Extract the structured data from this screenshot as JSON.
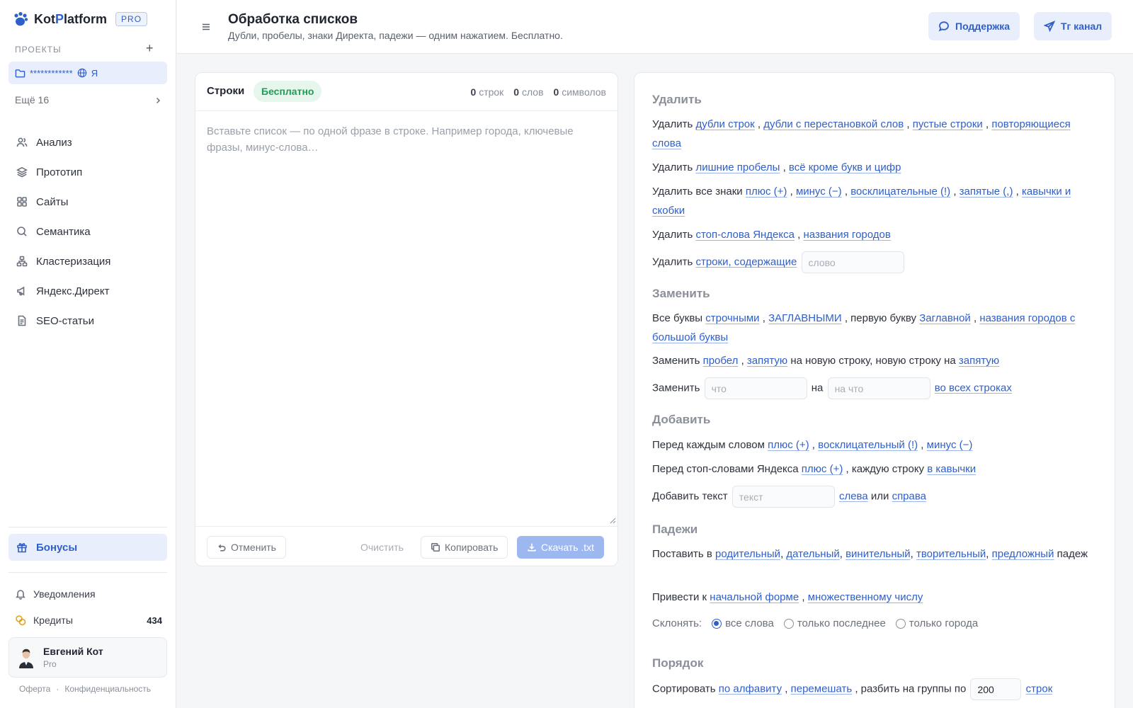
{
  "brand": {
    "name_pre": "Kot",
    "name_accent": "P",
    "name_post": "latform",
    "badge": "PRO"
  },
  "sidebar": {
    "projects_label": "ПРОЕКТЫ",
    "add_symbol": "+",
    "project": {
      "name": "************",
      "extra": "Я"
    },
    "more": "Ещё 16",
    "items": [
      {
        "label": "Анализ",
        "icon": "users-icon"
      },
      {
        "label": "Прототип",
        "icon": "layers-icon"
      },
      {
        "label": "Сайты",
        "icon": "grid-icon"
      },
      {
        "label": "Семантика",
        "icon": "search-icon"
      },
      {
        "label": "Кластеризация",
        "icon": "cluster-icon"
      },
      {
        "label": "Яндекс.Директ",
        "icon": "megaphone-icon"
      },
      {
        "label": "SEO-статьи",
        "icon": "document-icon"
      }
    ],
    "bonus": "Бонусы",
    "notifications": "Уведомления",
    "credits": {
      "label": "Кредиты",
      "value": "434"
    },
    "user": {
      "name": "Евгений Кот",
      "plan": "Pro"
    },
    "footer": {
      "offer": "Оферта",
      "sep": "·",
      "privacy": "Конфиденциальность"
    }
  },
  "header": {
    "title": "Обработка списков",
    "subtitle": "Дубли, пробелы, знаки Директа, падежи — одним нажатием. Бесплатно.",
    "support_label": "Поддержка",
    "tg_label": "Тг канал"
  },
  "editor": {
    "title": "Строки",
    "badge": "Бесплатно",
    "stats": {
      "lines": "0",
      "lines_label": "строк",
      "words": "0",
      "words_label": "слов",
      "chars": "0",
      "chars_label": "символов"
    },
    "placeholder": "Вставьте список — по одной фразе в строке. Например города, ключевые фразы, минус-слова…",
    "undo": "Отменить",
    "clear": "Очистить",
    "copy": "Копировать",
    "download": "Скачать .txt"
  },
  "tools": {
    "remove": {
      "heading": "Удалить",
      "l1_prefix": "Удалить",
      "l1_links": [
        "дубли строк",
        "дубли с перестановкой слов",
        "пустые строки",
        "повторяющиеся слова"
      ],
      "l2_prefix": "Удалить",
      "l2_links": [
        "лишние пробелы",
        "всё кроме букв и цифр"
      ],
      "l3_prefix": "Удалить все знаки",
      "l3_links": [
        "плюс (+)",
        "минус (−)",
        "восклицательные (!)",
        "запятые (,)",
        "кавычки и скобки"
      ],
      "l4_prefix": "Удалить",
      "l4_links": [
        "стоп-слова Яндекса",
        "названия городов"
      ],
      "l5_prefix": "Удалить",
      "l5_link": "строки, содержащие",
      "l5_placeholder": "слово"
    },
    "replace": {
      "heading": "Заменить",
      "l1_prefix": "Все буквы",
      "l1_links": [
        "строчными",
        "ЗАГЛАВНЫМИ"
      ],
      "l1_mid": ", первую букву",
      "l1_links2": [
        "Заглавной",
        "названия городов с большой буквы"
      ],
      "l2_prefix": "Заменить",
      "l2_links": [
        "пробел",
        "запятую"
      ],
      "l2_mid": "на новую строку, новую строку на",
      "l2_link_end": "запятую",
      "l3_prefix": "Заменить",
      "l3_placeholder_what": "что",
      "l3_on": "на",
      "l3_placeholder_to": "на что",
      "l3_link": "во всех строках"
    },
    "add": {
      "heading": "Добавить",
      "l1_prefix": "Перед каждым словом",
      "l1_links": [
        "плюс (+)",
        "восклицательный (!)",
        "минус (−)"
      ],
      "l2_prefix": "Перед стоп-словами Яндекса",
      "l2_link": "плюс (+)",
      "l2_mid": ", каждую строку",
      "l2_link2": "в кавычки",
      "l3_prefix": "Добавить текст",
      "l3_placeholder": "текст",
      "l3_left": "слева",
      "l3_or": "или",
      "l3_right": "справа"
    },
    "cases": {
      "heading": "Падежи",
      "l1_prefix": "Поставить в",
      "l1_links": [
        "родительный",
        "дательный",
        "винительный",
        "творительный",
        "предложный"
      ],
      "l1_suffix": "падеж",
      "l2_prefix": "Привести к",
      "l2_links": [
        "начальной форме",
        "множественному числу"
      ],
      "decline_label": "Склонять:",
      "options": [
        "все слова",
        "только последнее",
        "только города"
      ],
      "selected": "все слова"
    },
    "order": {
      "heading": "Порядок",
      "l1_prefix": "Сортировать",
      "l1_links": [
        "по алфавиту",
        "перемешать"
      ],
      "l1_mid": ", разбить на группы по",
      "group_value": "200",
      "l1_link_end": "строк"
    }
  },
  "colors": {
    "accent": "#2f5fc9",
    "accent_bg": "#e8eefb",
    "free_green": "#1f9d55"
  }
}
